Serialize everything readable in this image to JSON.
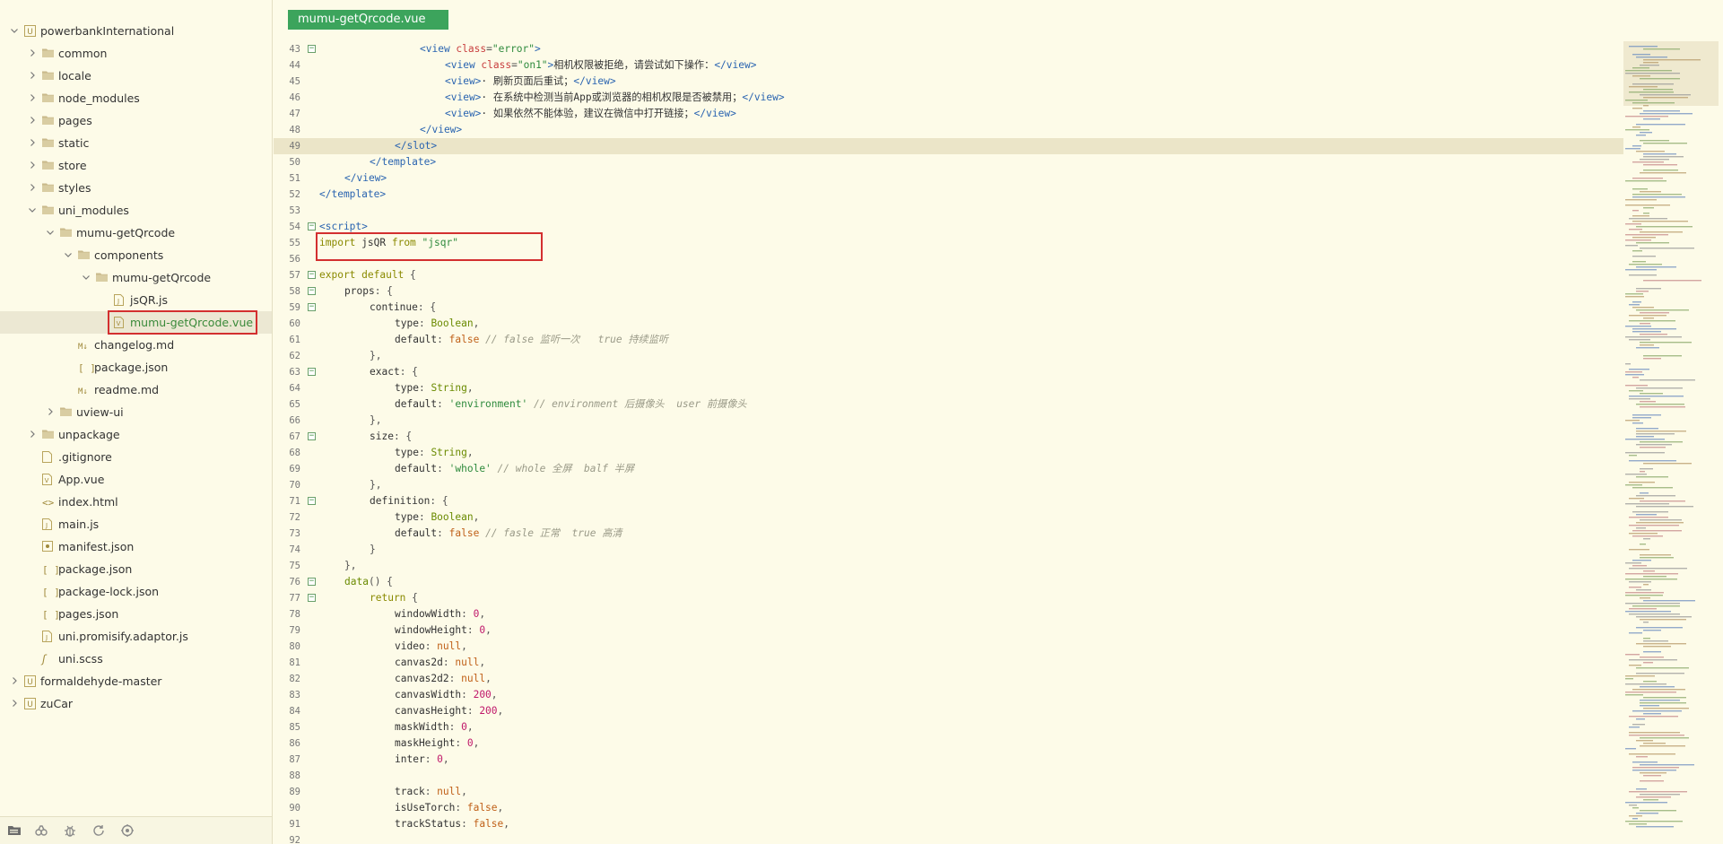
{
  "sidebar": {
    "tree": [
      {
        "label": "powerbankInternational",
        "depth": 0,
        "kind": "project",
        "expanded": true,
        "selected": false
      },
      {
        "label": "common",
        "depth": 1,
        "kind": "folder",
        "expanded": false,
        "selected": false
      },
      {
        "label": "locale",
        "depth": 1,
        "kind": "folder",
        "expanded": false,
        "selected": false
      },
      {
        "label": "node_modules",
        "depth": 1,
        "kind": "folder",
        "expanded": false,
        "selected": false
      },
      {
        "label": "pages",
        "depth": 1,
        "kind": "folder",
        "expanded": false,
        "selected": false
      },
      {
        "label": "static",
        "depth": 1,
        "kind": "folder",
        "expanded": false,
        "selected": false
      },
      {
        "label": "store",
        "depth": 1,
        "kind": "folder",
        "expanded": false,
        "selected": false
      },
      {
        "label": "styles",
        "depth": 1,
        "kind": "folder",
        "expanded": false,
        "selected": false
      },
      {
        "label": "uni_modules",
        "depth": 1,
        "kind": "folder",
        "expanded": true,
        "selected": false
      },
      {
        "label": "mumu-getQrcode",
        "depth": 2,
        "kind": "folder",
        "expanded": true,
        "selected": false
      },
      {
        "label": "components",
        "depth": 3,
        "kind": "folder",
        "expanded": true,
        "selected": false
      },
      {
        "label": "mumu-getQrcode",
        "depth": 4,
        "kind": "folder",
        "expanded": true,
        "selected": false
      },
      {
        "label": "jsQR.js",
        "depth": 5,
        "kind": "js",
        "selected": false
      },
      {
        "label": "mumu-getQrcode.vue",
        "depth": 5,
        "kind": "vue",
        "selected": true
      },
      {
        "label": "changelog.md",
        "depth": 3,
        "kind": "md",
        "selected": false
      },
      {
        "label": "package.json",
        "depth": 3,
        "kind": "json",
        "selected": false
      },
      {
        "label": "readme.md",
        "depth": 3,
        "kind": "md",
        "selected": false
      },
      {
        "label": "uview-ui",
        "depth": 2,
        "kind": "folder",
        "expanded": false,
        "selected": false
      },
      {
        "label": "unpackage",
        "depth": 1,
        "kind": "folder",
        "expanded": false,
        "selected": false
      },
      {
        "label": ".gitignore",
        "depth": 1,
        "kind": "file",
        "selected": false
      },
      {
        "label": "App.vue",
        "depth": 1,
        "kind": "vue",
        "selected": false
      },
      {
        "label": "index.html",
        "depth": 1,
        "kind": "html",
        "selected": false
      },
      {
        "label": "main.js",
        "depth": 1,
        "kind": "js",
        "selected": false
      },
      {
        "label": "manifest.json",
        "depth": 1,
        "kind": "manifest",
        "selected": false
      },
      {
        "label": "package.json",
        "depth": 1,
        "kind": "json",
        "selected": false
      },
      {
        "label": "package-lock.json",
        "depth": 1,
        "kind": "json",
        "selected": false
      },
      {
        "label": "pages.json",
        "depth": 1,
        "kind": "json",
        "selected": false
      },
      {
        "label": "uni.promisify.adaptor.js",
        "depth": 1,
        "kind": "js",
        "selected": false
      },
      {
        "label": "uni.scss",
        "depth": 1,
        "kind": "scss",
        "selected": false
      },
      {
        "label": "formaldehyde-master",
        "depth": 0,
        "kind": "project",
        "expanded": false,
        "selected": false
      },
      {
        "label": "zuCar",
        "depth": 0,
        "kind": "project",
        "expanded": false,
        "selected": false
      }
    ],
    "bottom_icons": [
      "project-tree-icon",
      "plugin-icon",
      "debug-bug-icon",
      "sync-icon",
      "extension-icon"
    ]
  },
  "editor": {
    "active_tab": "mumu-getQrcode.vue",
    "current_line": 49,
    "highlighted_line": 55,
    "lines": [
      {
        "n": 43,
        "fold": true,
        "indent": 4,
        "tokens": [
          [
            "tag",
            "<view "
          ],
          [
            "attr",
            "class"
          ],
          [
            "pun",
            "="
          ],
          [
            "str",
            "\"error\""
          ],
          [
            "tag",
            ">"
          ]
        ]
      },
      {
        "n": 44,
        "indent": 5,
        "tokens": [
          [
            "tag",
            "<view "
          ],
          [
            "attr",
            "class"
          ],
          [
            "pun",
            "="
          ],
          [
            "str",
            "\"on1\""
          ],
          [
            "tag",
            ">"
          ],
          [
            "txt",
            "相机权限被拒绝，请尝试如下操作："
          ],
          [
            "tag",
            "</view>"
          ]
        ]
      },
      {
        "n": 45,
        "indent": 5,
        "tokens": [
          [
            "tag",
            "<view>"
          ],
          [
            "txt",
            "· 刷新页面后重试；"
          ],
          [
            "tag",
            "</view>"
          ]
        ]
      },
      {
        "n": 46,
        "indent": 5,
        "tokens": [
          [
            "tag",
            "<view>"
          ],
          [
            "txt",
            "· 在系统中检测当前App或浏览器的相机权限是否被禁用；"
          ],
          [
            "tag",
            "</view>"
          ]
        ]
      },
      {
        "n": 47,
        "indent": 5,
        "tokens": [
          [
            "tag",
            "<view>"
          ],
          [
            "txt",
            "· 如果依然不能体验，建议在微信中打开链接；"
          ],
          [
            "tag",
            "</view>"
          ]
        ]
      },
      {
        "n": 48,
        "indent": 4,
        "tokens": [
          [
            "tag",
            "</view>"
          ]
        ]
      },
      {
        "n": 49,
        "indent": 3,
        "tokens": [
          [
            "tag",
            "</slot>"
          ]
        ]
      },
      {
        "n": 50,
        "indent": 2,
        "tokens": [
          [
            "tag",
            "</template>"
          ]
        ]
      },
      {
        "n": 51,
        "indent": 1,
        "tokens": [
          [
            "tag",
            "</view>"
          ]
        ]
      },
      {
        "n": 52,
        "indent": 0,
        "tokens": [
          [
            "tag",
            "</template>"
          ]
        ]
      },
      {
        "n": 53,
        "indent": 0,
        "tokens": []
      },
      {
        "n": 54,
        "fold": true,
        "indent": 0,
        "tokens": [
          [
            "tag",
            "<script>"
          ]
        ]
      },
      {
        "n": 55,
        "indent": 0,
        "tokens": [
          [
            "kw",
            "import "
          ],
          [
            "key",
            "jsQR "
          ],
          [
            "kw",
            "from "
          ],
          [
            "str",
            "\"jsqr\""
          ]
        ]
      },
      {
        "n": 56,
        "indent": 0,
        "tokens": []
      },
      {
        "n": 57,
        "fold": true,
        "indent": 0,
        "tokens": [
          [
            "kw",
            "export default "
          ],
          [
            "pun",
            "{"
          ]
        ]
      },
      {
        "n": 58,
        "fold": true,
        "indent": 1,
        "tokens": [
          [
            "key",
            "props"
          ],
          [
            "pun",
            ": {"
          ]
        ]
      },
      {
        "n": 59,
        "fold": true,
        "indent": 2,
        "tokens": [
          [
            "key",
            "continue"
          ],
          [
            "pun",
            ": {"
          ]
        ]
      },
      {
        "n": 60,
        "indent": 3,
        "tokens": [
          [
            "key",
            "type"
          ],
          [
            "pun",
            ": "
          ],
          [
            "type",
            "Boolean"
          ],
          [
            "pun",
            ","
          ]
        ]
      },
      {
        "n": 61,
        "indent": 3,
        "tokens": [
          [
            "key",
            "default"
          ],
          [
            "pun",
            ": "
          ],
          [
            "bool",
            "false "
          ],
          [
            "com",
            "// false 监听一次   true 持续监听"
          ]
        ]
      },
      {
        "n": 62,
        "indent": 2,
        "tokens": [
          [
            "pun",
            "},"
          ]
        ]
      },
      {
        "n": 63,
        "fold": true,
        "indent": 2,
        "tokens": [
          [
            "key",
            "exact"
          ],
          [
            "pun",
            ": {"
          ]
        ]
      },
      {
        "n": 64,
        "indent": 3,
        "tokens": [
          [
            "key",
            "type"
          ],
          [
            "pun",
            ": "
          ],
          [
            "type",
            "String"
          ],
          [
            "pun",
            ","
          ]
        ]
      },
      {
        "n": 65,
        "indent": 3,
        "tokens": [
          [
            "key",
            "default"
          ],
          [
            "pun",
            ": "
          ],
          [
            "str",
            "'environment' "
          ],
          [
            "com",
            "// environment 后摄像头  user 前摄像头"
          ]
        ]
      },
      {
        "n": 66,
        "indent": 2,
        "tokens": [
          [
            "pun",
            "},"
          ]
        ]
      },
      {
        "n": 67,
        "fold": true,
        "indent": 2,
        "tokens": [
          [
            "key",
            "size"
          ],
          [
            "pun",
            ": {"
          ]
        ]
      },
      {
        "n": 68,
        "indent": 3,
        "tokens": [
          [
            "key",
            "type"
          ],
          [
            "pun",
            ": "
          ],
          [
            "type",
            "String"
          ],
          [
            "pun",
            ","
          ]
        ]
      },
      {
        "n": 69,
        "indent": 3,
        "tokens": [
          [
            "key",
            "default"
          ],
          [
            "pun",
            ": "
          ],
          [
            "str",
            "'whole' "
          ],
          [
            "com",
            "// whole 全屏  balf 半屏"
          ]
        ]
      },
      {
        "n": 70,
        "indent": 2,
        "tokens": [
          [
            "pun",
            "},"
          ]
        ]
      },
      {
        "n": 71,
        "fold": true,
        "indent": 2,
        "tokens": [
          [
            "key",
            "definition"
          ],
          [
            "pun",
            ": {"
          ]
        ]
      },
      {
        "n": 72,
        "indent": 3,
        "tokens": [
          [
            "key",
            "type"
          ],
          [
            "pun",
            ": "
          ],
          [
            "type",
            "Boolean"
          ],
          [
            "pun",
            ","
          ]
        ]
      },
      {
        "n": 73,
        "indent": 3,
        "tokens": [
          [
            "key",
            "default"
          ],
          [
            "pun",
            ": "
          ],
          [
            "bool",
            "false "
          ],
          [
            "com",
            "// fasle 正常  true 高清"
          ]
        ]
      },
      {
        "n": 74,
        "indent": 2,
        "tokens": [
          [
            "pun",
            "}"
          ]
        ]
      },
      {
        "n": 75,
        "indent": 1,
        "tokens": [
          [
            "pun",
            "},"
          ]
        ]
      },
      {
        "n": 76,
        "fold": true,
        "indent": 1,
        "tokens": [
          [
            "type",
            "data"
          ],
          [
            "pun",
            "() {"
          ]
        ]
      },
      {
        "n": 77,
        "fold": true,
        "indent": 2,
        "tokens": [
          [
            "kw",
            "return "
          ],
          [
            "pun",
            "{"
          ]
        ]
      },
      {
        "n": 78,
        "indent": 3,
        "tokens": [
          [
            "key",
            "windowWidth"
          ],
          [
            "pun",
            ": "
          ],
          [
            "num",
            "0"
          ],
          [
            "pun",
            ","
          ]
        ]
      },
      {
        "n": 79,
        "indent": 3,
        "tokens": [
          [
            "key",
            "windowHeight"
          ],
          [
            "pun",
            ": "
          ],
          [
            "num",
            "0"
          ],
          [
            "pun",
            ","
          ]
        ]
      },
      {
        "n": 80,
        "indent": 3,
        "tokens": [
          [
            "key",
            "video"
          ],
          [
            "pun",
            ": "
          ],
          [
            "bool",
            "null"
          ],
          [
            "pun",
            ","
          ]
        ]
      },
      {
        "n": 81,
        "indent": 3,
        "tokens": [
          [
            "key",
            "canvas2d"
          ],
          [
            "pun",
            ": "
          ],
          [
            "bool",
            "null"
          ],
          [
            "pun",
            ","
          ]
        ]
      },
      {
        "n": 82,
        "indent": 3,
        "tokens": [
          [
            "key",
            "canvas2d2"
          ],
          [
            "pun",
            ": "
          ],
          [
            "bool",
            "null"
          ],
          [
            "pun",
            ","
          ]
        ]
      },
      {
        "n": 83,
        "indent": 3,
        "tokens": [
          [
            "key",
            "canvasWidth"
          ],
          [
            "pun",
            ": "
          ],
          [
            "num",
            "200"
          ],
          [
            "pun",
            ","
          ]
        ]
      },
      {
        "n": 84,
        "indent": 3,
        "tokens": [
          [
            "key",
            "canvasHeight"
          ],
          [
            "pun",
            ": "
          ],
          [
            "num",
            "200"
          ],
          [
            "pun",
            ","
          ]
        ]
      },
      {
        "n": 85,
        "indent": 3,
        "tokens": [
          [
            "key",
            "maskWidth"
          ],
          [
            "pun",
            ": "
          ],
          [
            "num",
            "0"
          ],
          [
            "pun",
            ","
          ]
        ]
      },
      {
        "n": 86,
        "indent": 3,
        "tokens": [
          [
            "key",
            "maskHeight"
          ],
          [
            "pun",
            ": "
          ],
          [
            "num",
            "0"
          ],
          [
            "pun",
            ","
          ]
        ]
      },
      {
        "n": 87,
        "indent": 3,
        "tokens": [
          [
            "key",
            "inter"
          ],
          [
            "pun",
            ": "
          ],
          [
            "num",
            "0"
          ],
          [
            "pun",
            ","
          ]
        ]
      },
      {
        "n": 88,
        "indent": 0,
        "tokens": []
      },
      {
        "n": 89,
        "indent": 3,
        "tokens": [
          [
            "key",
            "track"
          ],
          [
            "pun",
            ": "
          ],
          [
            "bool",
            "null"
          ],
          [
            "pun",
            ","
          ]
        ]
      },
      {
        "n": 90,
        "indent": 3,
        "tokens": [
          [
            "key",
            "isUseTorch"
          ],
          [
            "pun",
            ": "
          ],
          [
            "bool",
            "false"
          ],
          [
            "pun",
            ","
          ]
        ]
      },
      {
        "n": 91,
        "indent": 3,
        "tokens": [
          [
            "key",
            "trackStatus"
          ],
          [
            "pun",
            ": "
          ],
          [
            "bool",
            "false"
          ],
          [
            "pun",
            ","
          ]
        ]
      },
      {
        "n": 92,
        "indent": 0,
        "tokens": []
      }
    ]
  },
  "colors": {
    "background": "#fdfbe8",
    "tab_active": "#3ca45c",
    "highlight_border": "#d32f2f",
    "selected_row": "#ece8d3"
  }
}
